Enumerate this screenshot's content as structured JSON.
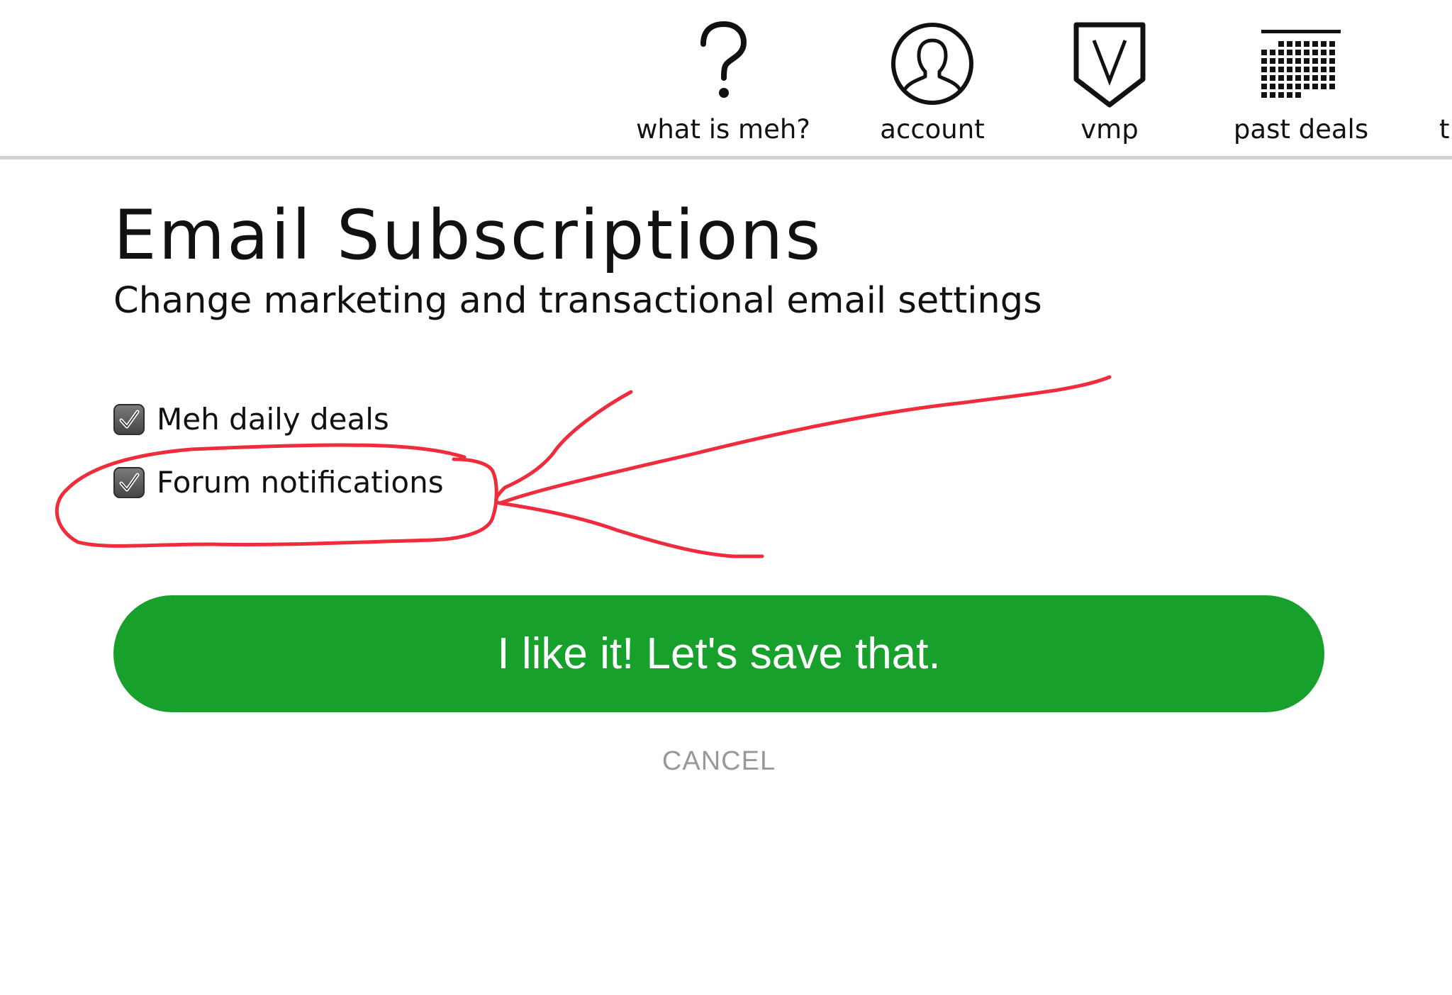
{
  "nav": {
    "items": [
      {
        "label": "what is meh?",
        "icon": "question-mark-icon"
      },
      {
        "label": "account",
        "icon": "user-circle-icon"
      },
      {
        "label": "vmp",
        "icon": "v-shield-icon"
      },
      {
        "label": "past deals",
        "icon": "calendar-grid-icon"
      },
      {
        "label": "t",
        "icon": ""
      }
    ]
  },
  "page": {
    "title": "Email Subscriptions",
    "subtitle": "Change marketing and transactional email settings"
  },
  "options": [
    {
      "label": "Meh daily deals",
      "checked": true
    },
    {
      "label": "Forum notifications",
      "checked": true
    }
  ],
  "actions": {
    "save_label": "I like it! Let's save that.",
    "cancel_label": "CANCEL"
  },
  "colors": {
    "save_button": "#17a02c",
    "annotation": "#ee2c3c",
    "cancel_text": "#999999",
    "divider": "#cfcfcf"
  }
}
